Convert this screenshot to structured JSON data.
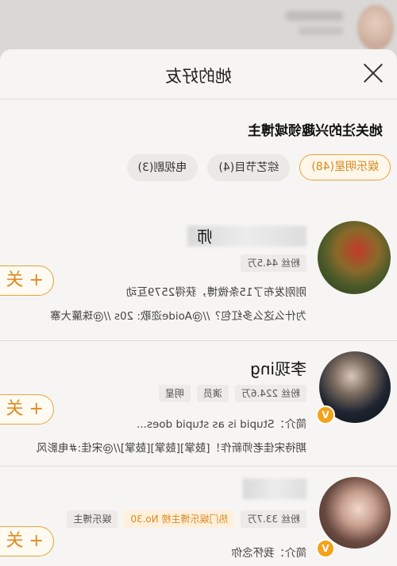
{
  "header": {
    "title": "她的好友"
  },
  "section": {
    "title": "她关注的兴趣领域博主"
  },
  "tabs": [
    {
      "label": "娱乐明星(48)",
      "active": true
    },
    {
      "label": "综艺节目(4)",
      "active": false
    },
    {
      "label": "电视剧(3)",
      "active": false
    }
  ],
  "users": [
    {
      "name_visible": "师",
      "tags": [
        "粉丝 44.5万"
      ],
      "lines": [
        "刚刚发布了15条微博，获得2579互动",
        "为什么这么多红包？//@Aoide迩歌: 20s //@珠簾大寨"
      ],
      "follow_label": "+ 关"
    },
    {
      "name_visible": "李现ing",
      "tags": [
        "粉丝 224.6万",
        "演员",
        "明星"
      ],
      "lines": [
        "简介：Stupid is as stupid does...",
        "期待宋佳老师新作！[鼓掌][鼓掌][鼓掌]//@宋佳:#电影风"
      ],
      "follow_label": "+ 关"
    },
    {
      "name_visible": "",
      "tags": [
        "粉丝 33.7万",
        "热门娱乐博主榜 No.30",
        "娱乐博主"
      ],
      "lines": [
        "简介：我怀念你"
      ],
      "follow_label": "+ 关"
    }
  ],
  "colors": {
    "accent": "#e7a33a",
    "verify": "#f5a21b"
  },
  "icons": {
    "close": "close-icon",
    "follow": "plus-icon",
    "verified": "verified-badge-icon"
  }
}
